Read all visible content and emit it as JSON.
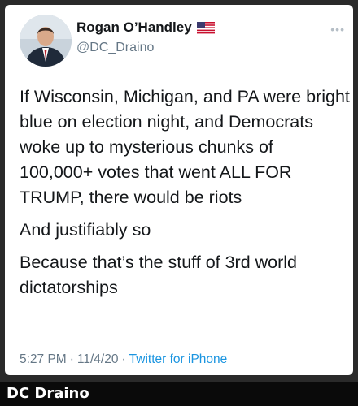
{
  "tweet": {
    "author": {
      "display_name": "Rogan O’Handley",
      "handle": "@DC_Draino",
      "badge_icon": "us-flag-icon"
    },
    "more_icon": "more-options-icon",
    "body": [
      "If Wisconsin, Michigan, and PA were bright blue on election night, and Democrats woke up to mysterious chunks of 100,000+ votes that went ALL FOR TRUMP, there would be riots",
      "And justifiably so",
      "Because that’s the stuff of 3rd world dictatorships"
    ],
    "time": "5:27 PM",
    "date": "11/4/20",
    "separator": "·",
    "source": "Twitter for iPhone"
  },
  "watermark": "DC Draino",
  "colors": {
    "text": "#14171a",
    "muted": "#657786",
    "link": "#1b95e0",
    "watermark_bg": "#0a0a0a"
  }
}
